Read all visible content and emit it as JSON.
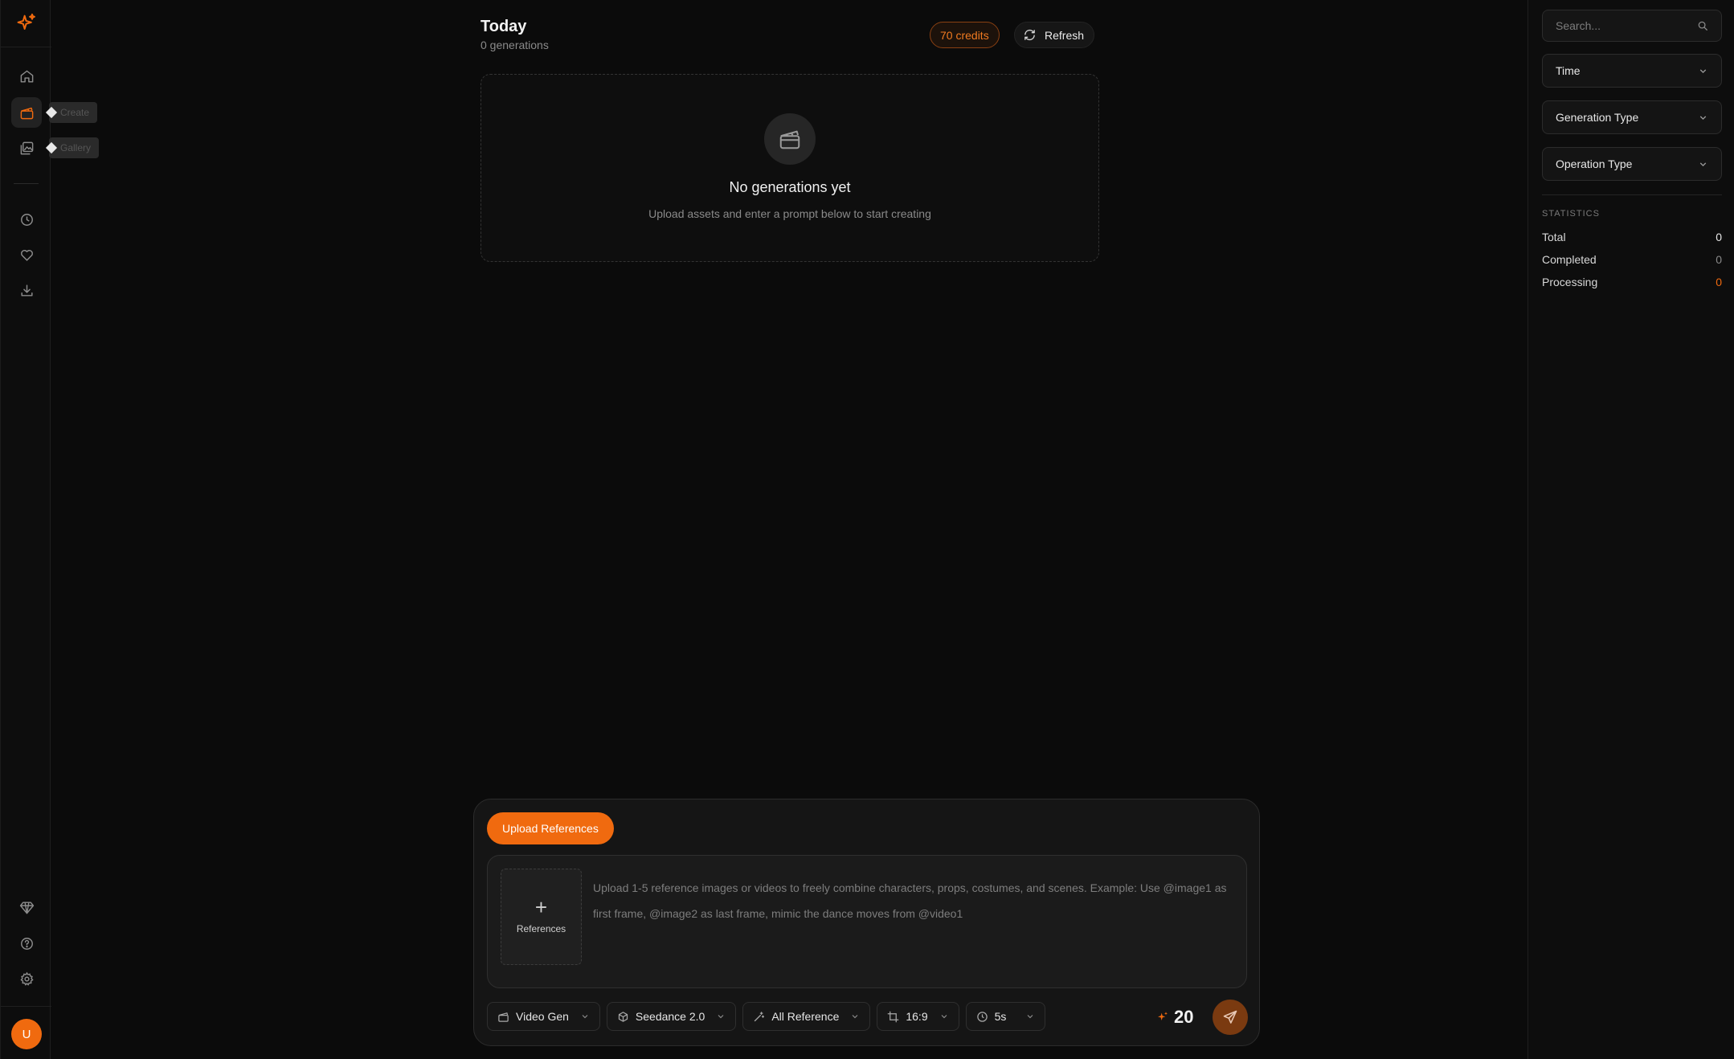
{
  "sidebar": {
    "tooltips": {
      "create": "Create",
      "gallery": "Gallery"
    },
    "avatar_initial": "U"
  },
  "header": {
    "title": "Today",
    "subtitle": "0 generations",
    "credits": "70 credits",
    "refresh_label": "Refresh"
  },
  "empty_state": {
    "title": "No generations yet",
    "description": "Upload assets and enter a prompt below to start creating"
  },
  "composer": {
    "upload_label": "Upload References",
    "references_label": "References",
    "placeholder": "Upload 1-5 reference images or videos to freely combine characters, props, costumes, and scenes. Example: Use @image1 as first frame, @image2 as last frame, mimic the dance moves from @video1",
    "mode": "Video Gen",
    "model": "Seedance 2.0",
    "reference_mode": "All Reference",
    "aspect_ratio": "16:9",
    "duration": "5s",
    "cost": "20"
  },
  "filters": {
    "search_placeholder": "Search...",
    "time": "Time",
    "generation_type": "Generation Type",
    "operation_type": "Operation Type"
  },
  "statistics": {
    "title": "STATISTICS",
    "rows": [
      {
        "label": "Total",
        "value": "0"
      },
      {
        "label": "Completed",
        "value": "0"
      },
      {
        "label": "Processing",
        "value": "0"
      }
    ]
  },
  "colors": {
    "accent": "#f06a0f",
    "background": "#0b0b0b"
  }
}
